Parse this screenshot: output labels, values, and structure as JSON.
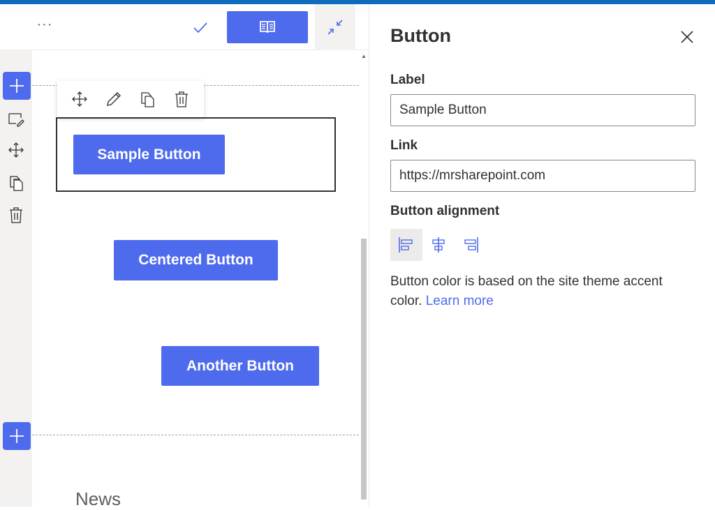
{
  "colors": {
    "accent": "#4f6bed",
    "topbar": "#0f6cbd"
  },
  "command_bar": {
    "more_label": "···",
    "more_icon": "ellipsis-icon",
    "check_icon": "check-icon",
    "book_icon": "book-icon",
    "collapse_icon": "collapse-icon"
  },
  "side_tools": [
    "add-section-icon",
    "edit-section-icon",
    "move-icon",
    "copy-icon",
    "delete-icon"
  ],
  "webpart_toolbar": [
    "move-icon",
    "edit-icon",
    "duplicate-icon",
    "delete-icon"
  ],
  "canvas": {
    "buttons": [
      {
        "label": "Sample Button"
      },
      {
        "label": "Centered Button"
      },
      {
        "label": "Another Button"
      }
    ],
    "news_heading": "News"
  },
  "pane": {
    "title": "Button",
    "label_field": {
      "label": "Label",
      "value": "Sample Button"
    },
    "link_field": {
      "label": "Link",
      "value": "https://mrsharepoint.com"
    },
    "alignment": {
      "label": "Button alignment",
      "options": [
        "left",
        "center",
        "right"
      ],
      "selected": "left"
    },
    "help_text": "Button color is based on the site theme accent color.",
    "help_link": "Learn more"
  }
}
